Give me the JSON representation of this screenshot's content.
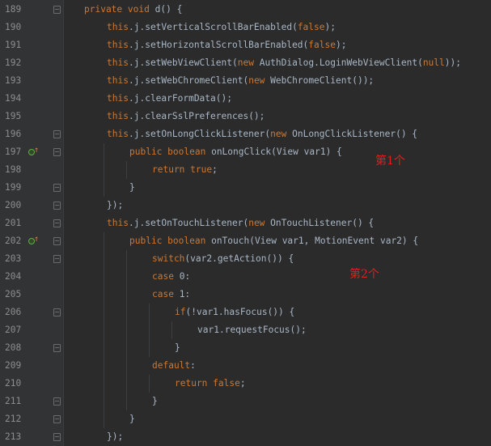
{
  "editor": {
    "lines": [
      {
        "num": "189",
        "text": "private void d() {"
      },
      {
        "num": "190",
        "text": "this.j.setVerticalScrollBarEnabled(false);"
      },
      {
        "num": "191",
        "text": "this.j.setHorizontalScrollBarEnabled(false);"
      },
      {
        "num": "192",
        "text": "this.j.setWebViewClient(new AuthDialog.LoginWebViewClient(null));"
      },
      {
        "num": "193",
        "text": "this.j.setWebChromeClient(new WebChromeClient());"
      },
      {
        "num": "194",
        "text": "this.j.clearFormData();"
      },
      {
        "num": "195",
        "text": "this.j.clearSslPreferences();"
      },
      {
        "num": "196",
        "text": "this.j.setOnLongClickListener(new OnLongClickListener() {"
      },
      {
        "num": "197",
        "text": "public boolean onLongClick(View var1) {"
      },
      {
        "num": "198",
        "text": "return true;"
      },
      {
        "num": "199",
        "text": "}"
      },
      {
        "num": "200",
        "text": "});"
      },
      {
        "num": "201",
        "text": "this.j.setOnTouchListener(new OnTouchListener() {"
      },
      {
        "num": "202",
        "text": "public boolean onTouch(View var1, MotionEvent var2) {"
      },
      {
        "num": "203",
        "text": "switch(var2.getAction()) {"
      },
      {
        "num": "204",
        "text": "case 0:"
      },
      {
        "num": "205",
        "text": "case 1:"
      },
      {
        "num": "206",
        "text": "if(!var1.hasFocus()) {"
      },
      {
        "num": "207",
        "text": "var1.requestFocus();"
      },
      {
        "num": "208",
        "text": "}"
      },
      {
        "num": "209",
        "text": "default:"
      },
      {
        "num": "210",
        "text": "return false;"
      },
      {
        "num": "211",
        "text": "}"
      },
      {
        "num": "212",
        "text": "}"
      },
      {
        "num": "213",
        "text": "});"
      }
    ],
    "annotations": {
      "first": "第1个",
      "second": "第2个"
    },
    "colors": {
      "background": "#2b2b2b",
      "gutter": "#313335",
      "keyword": "#cc7832",
      "text": "#a9b7c6",
      "annotation": "#e02020"
    }
  }
}
